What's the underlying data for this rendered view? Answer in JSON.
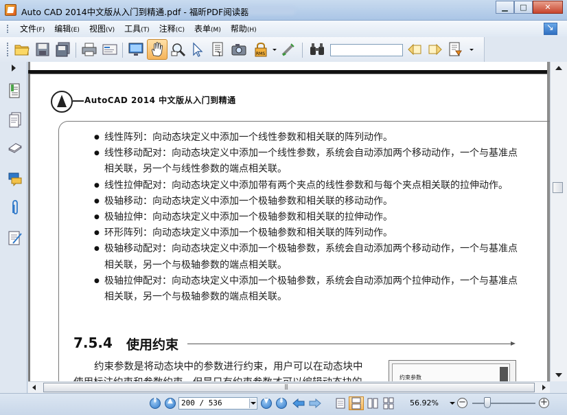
{
  "window": {
    "title": "Auto CAD 2014中文版从入门到精通.pdf - 福昕PDF阅读器",
    "minimize": "▁",
    "maximize": "□",
    "close": "✕"
  },
  "menu": {
    "items": [
      {
        "label": "文件",
        "accel": "(F)"
      },
      {
        "label": "编辑",
        "accel": "(E)"
      },
      {
        "label": "视图",
        "accel": "(V)"
      },
      {
        "label": "工具",
        "accel": "(T)"
      },
      {
        "label": "注释",
        "accel": "(C)"
      },
      {
        "label": "表单",
        "accel": "(M)"
      },
      {
        "label": "帮助",
        "accel": "(H)"
      }
    ]
  },
  "toolbar": {
    "icons": [
      "open-folder-icon",
      "save-icon",
      "save-as-icon",
      "print-icon",
      "properties-icon",
      "fullscreen-icon",
      "hand-tool-icon",
      "zoom-tool-icon",
      "select-tool-icon",
      "text-select-icon",
      "snapshot-icon",
      "rms-lock-icon",
      "typewriter-icon",
      "binoculars-icon",
      "find-prev-icon",
      "find-next-icon",
      "highlight-icon"
    ],
    "search_value": "",
    "rms_label": "RMS"
  },
  "document": {
    "header_title": "AutoCAD 2014 中文版从入门到精通",
    "bullets": [
      "线性阵列：向动态块定义中添加一个线性参数和相关联的阵列动作。",
      "线性移动配对：向动态块定义中添加一个线性参数，系统会自动添加两个移动动作，一个与基准点相关联，另一个与线性参数的端点相关联。",
      "线性拉伸配对：向动态块定义中添加带有两个夹点的线性参数和与每个夹点相关联的拉伸动作。",
      "极轴移动：向动态块定义中添加一个极轴参数和相关联的移动动作。",
      "极轴拉伸：向动态块定义中添加一个极轴参数和相关联的拉伸动作。",
      "环形阵列：向动态块定义中添加一个极轴参数和相关联的阵列动作。",
      "极轴移动配对：向动态块定义中添加一个极轴参数，系统会自动添加两个移动动作，一个与基准点相关联，另一个与极轴参数的端点相关联。",
      "极轴拉伸配对：向动态块定义中添加一个极轴参数，系统会自动添加两个拉伸动作，一个与基准点相关联，另一个与极轴参数的端点相关联。"
    ],
    "section_number": "7.5.4",
    "section_title": "使用约束",
    "paragraph_line1": "约束参数是将动态块中的参数进行约束，用户可以在动态块中",
    "paragraph_line2": "使用标注约束和参数约束，但是只有约束参数才可以编辑动态块的",
    "figure_label": "约束参数"
  },
  "statusbar": {
    "page_display": "200 / 536",
    "zoom": "56.92%"
  },
  "colors": {
    "accent": "#2e78c9",
    "titlebar": "#aac5e6"
  }
}
